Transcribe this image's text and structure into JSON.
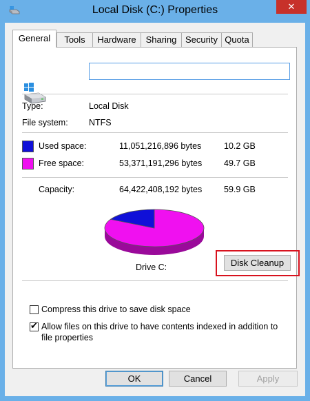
{
  "window": {
    "title": "Local Disk (C:) Properties",
    "close_glyph": "✕"
  },
  "tabs": [
    {
      "label": "General",
      "active": true
    },
    {
      "label": "Tools"
    },
    {
      "label": "Hardware"
    },
    {
      "label": "Sharing"
    },
    {
      "label": "Security"
    },
    {
      "label": "Quota"
    }
  ],
  "drive": {
    "name_value": "",
    "type_label": "Type:",
    "type_value": "Local Disk",
    "fs_label": "File system:",
    "fs_value": "NTFS"
  },
  "space": {
    "used_label": "Used space:",
    "used_bytes": "11,051,216,896 bytes",
    "used_size": "10.2 GB",
    "used_color": "#1010d8",
    "free_label": "Free space:",
    "free_bytes": "53,371,191,296 bytes",
    "free_size": "49.7 GB",
    "free_color": "#f010f0",
    "capacity_label": "Capacity:",
    "capacity_bytes": "64,422,408,192 bytes",
    "capacity_size": "59.9 GB",
    "used_fraction": 0.1715
  },
  "chart_label": "Drive C:",
  "disk_cleanup_label": "Disk Cleanup",
  "options": {
    "compress_label": "Compress this drive to save disk space",
    "compress_checked": false,
    "index_label_line1": "Allow files on this drive to have contents indexed in addition to",
    "index_label_line2": "file properties",
    "index_checked": true,
    "check_glyph": "✔"
  },
  "buttons": {
    "ok": "OK",
    "cancel": "Cancel",
    "apply": "Apply"
  },
  "icons": {
    "title_icon": "drive-icon",
    "drive_icon": "drive-icon"
  }
}
